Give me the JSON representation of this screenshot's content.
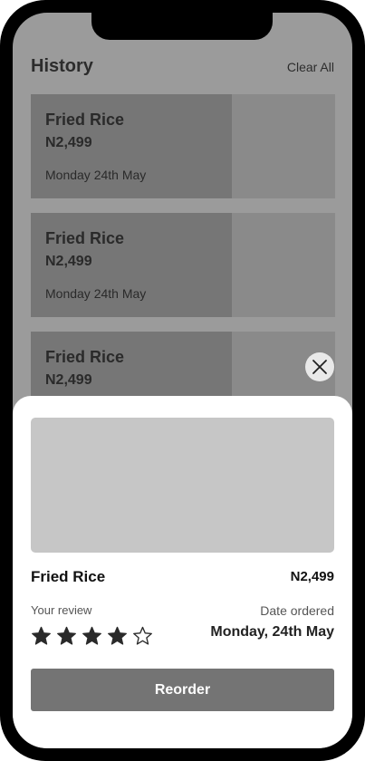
{
  "header": {
    "title": "History",
    "clear_all": "Clear All"
  },
  "history": [
    {
      "name": "Fried Rice",
      "price": "N2,499",
      "date": "Monday 24th May"
    },
    {
      "name": "Fried Rice",
      "price": "N2,499",
      "date": "Monday 24th May"
    },
    {
      "name": "Fried Rice",
      "price": "N2,499",
      "date": ""
    }
  ],
  "sheet": {
    "name": "Fried Rice",
    "price": "N2,499",
    "review_label": "Your review",
    "rating": 4,
    "rating_max": 5,
    "date_label": "Date ordered",
    "date_value": "Monday, 24th May",
    "reorder_label": "Reorder"
  },
  "colors": {
    "overlay": "#9b9b9b",
    "card": "#8a8a8a",
    "card_left": "#767676",
    "button": "#747474",
    "star": "#2a2a2a"
  },
  "icons": {
    "close": "close-icon",
    "star_filled": "star-filled-icon",
    "star_empty": "star-outline-icon"
  }
}
